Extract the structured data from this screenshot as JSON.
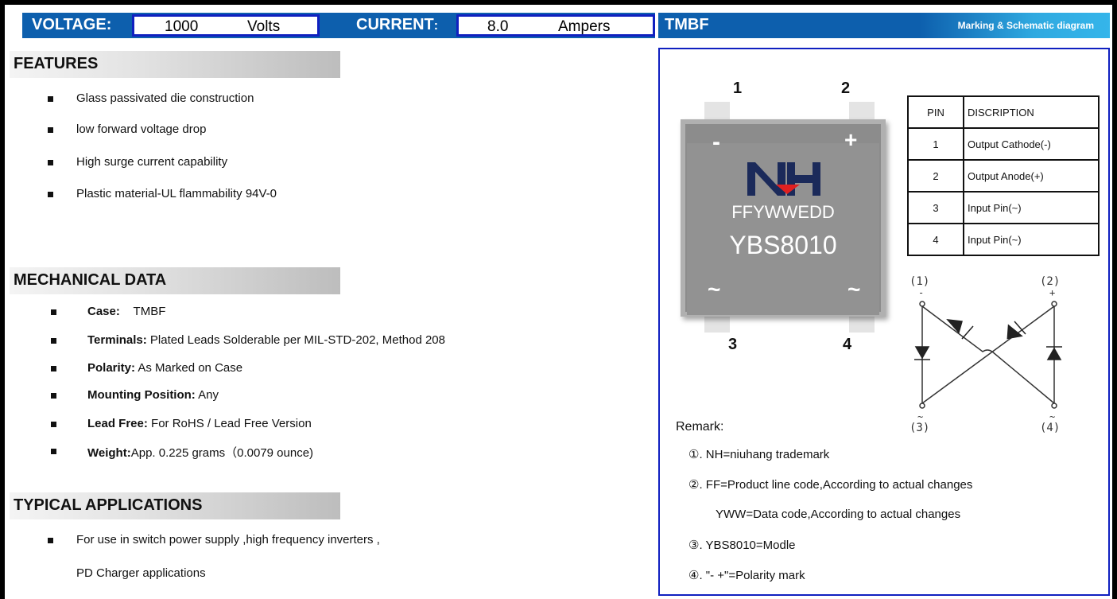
{
  "header": {
    "voltage_label": "VOLTAGE:",
    "voltage_value": "1000",
    "voltage_unit": "Volts",
    "current_label": "CURRENT",
    "current_colon": ":",
    "current_value": "8.0",
    "current_unit": "Ampers",
    "package_title": "TMBF",
    "diagram_title": "Marking & Schematic diagram"
  },
  "features": {
    "title": "FEATURES",
    "items": [
      "Glass passivated die construction",
      "low forward voltage drop",
      "High surge current capability",
      "Plastic material-UL flammability 94V-0"
    ]
  },
  "mechanical": {
    "title": "MECHANICAL DATA",
    "items": [
      {
        "label": "Case:",
        "text": "TMBF"
      },
      {
        "label": "Terminals:",
        "text": "Plated Leads Solderable per MIL-STD-202, Method 208"
      },
      {
        "label": "Polarity:",
        "text": "As Marked on Case"
      },
      {
        "label": "Mounting Position:",
        "text": "Any"
      },
      {
        "label": "Lead Free:",
        "text": "For RoHS / Lead Free Version"
      },
      {
        "label": "Weight:",
        "text": "App. 0.225 grams（0.0079 ounce)"
      }
    ]
  },
  "applications": {
    "title": "TYPICAL APPLICATIONS",
    "line1": "For use in switch power supply ,high frequency inverters ,",
    "line2": "PD Charger applications"
  },
  "chip": {
    "pin_numbers": [
      "1",
      "2",
      "3",
      "4"
    ],
    "minus": "-",
    "plus": "+",
    "tilde": "~",
    "logo": "NH",
    "code_line": "FFYWWEDD",
    "model_line": "YBS8010"
  },
  "pin_table": {
    "headers": [
      "PIN",
      "DISCRIPTION"
    ],
    "rows": [
      [
        "1",
        "Output Cathode(-)"
      ],
      [
        "2",
        "Output Anode(+)"
      ],
      [
        "3",
        "Input Pin(~)"
      ],
      [
        "4",
        "Input Pin(~)"
      ]
    ]
  },
  "schematic": {
    "labels": [
      "(1)",
      "(2)",
      "(3)",
      "(4)"
    ],
    "minus": "-",
    "plus": "+",
    "tilde": "~"
  },
  "remark": {
    "title": "Remark:",
    "items": [
      "①. NH=niuhang trademark",
      "②. FF=Product line code,According to actual changes",
      "YWW=Data code,According to actual changes",
      "③. YBS8010=Modle",
      "④. \"-  +\"=Polarity mark"
    ]
  },
  "colors": {
    "header_blue": "#0d5fad",
    "box_border": "#1020c0",
    "logo_navy": "#1b2a5a",
    "logo_red": "#e02020"
  }
}
